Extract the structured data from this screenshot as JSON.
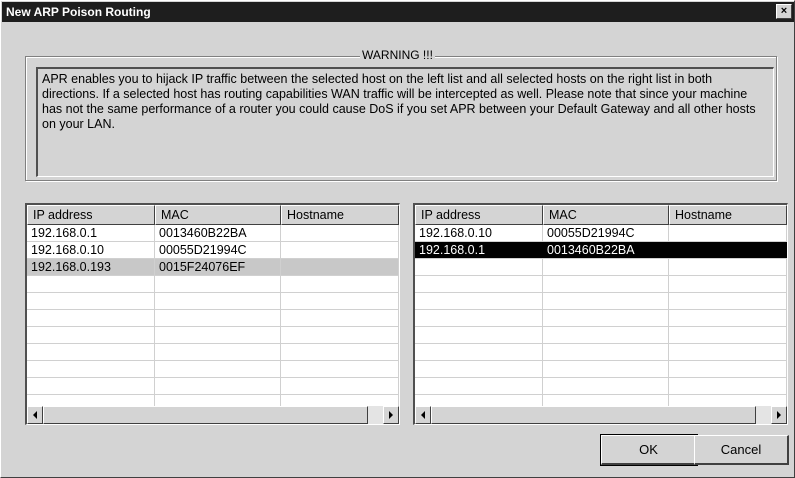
{
  "window": {
    "title": "New ARP Poison Routing",
    "close_label": "×"
  },
  "warning": {
    "title": "WARNING !!!",
    "text": "APR enables you to hijack IP traffic between the selected host on the left list and all selected hosts on the right list in both directions. If a selected host has routing capabilities WAN traffic will be intercepted as well. Please note that since your machine has not the same performance of a router you could cause DoS if you set APR between your Default Gateway and all other hosts on your LAN."
  },
  "left_list": {
    "columns": [
      "IP address",
      "MAC",
      "Hostname"
    ],
    "rows": [
      {
        "ip": "192.168.0.1",
        "mac": "0013460B22BA",
        "hostname": "",
        "selected": false
      },
      {
        "ip": "192.168.0.10",
        "mac": "00055D21994C",
        "hostname": "",
        "selected": false
      },
      {
        "ip": "192.168.0.193",
        "mac": "0015F24076EF",
        "hostname": "",
        "selected": true
      }
    ]
  },
  "right_list": {
    "columns": [
      "IP address",
      "MAC",
      "Hostname"
    ],
    "rows": [
      {
        "ip": "192.168.0.10",
        "mac": "00055D21994C",
        "hostname": "",
        "selected": false
      },
      {
        "ip": "192.168.0.1",
        "mac": "0013460B22BA",
        "hostname": "",
        "selected": true
      }
    ]
  },
  "buttons": {
    "ok": "OK",
    "cancel": "Cancel"
  }
}
